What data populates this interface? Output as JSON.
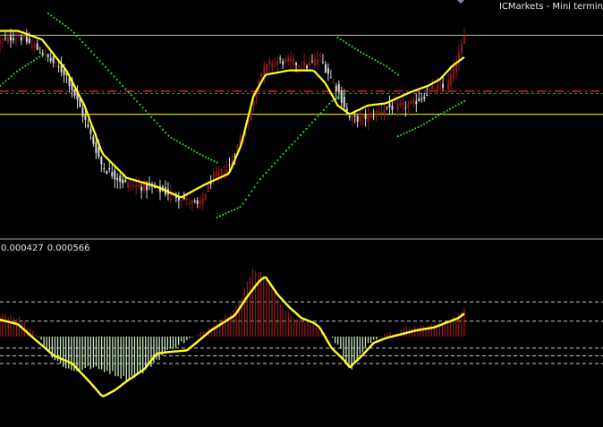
{
  "window": {
    "broker_label": "ICMarkets - Mini termin"
  },
  "colors": {
    "background": "#000000",
    "bull_candle": "#8b1a1a",
    "bear_candle": "#d8d8d8",
    "ma_line": "#ffff22",
    "envelope_dots": "#2ee82e",
    "level_line": "#ffff00",
    "mid_level_red": "#ff2a2a",
    "mid_level_green": "#00c000",
    "hist_pos": "#8b1a1a",
    "hist_neg": "#c8e8c0",
    "signal_line": "#ffff22",
    "osc_level": "#c8c8c8",
    "divider": "#a0a0a0"
  },
  "indicator": {
    "value_1": "0.000427",
    "value_2": "0.000566"
  },
  "chart_data": [
    {
      "type": "candlestick",
      "title": "",
      "xlabel": "",
      "ylabel": "",
      "grid": false,
      "ylim": [
        0,
        100
      ],
      "close_path": [
        [
          0,
          85
        ],
        [
          0.03,
          88
        ],
        [
          0.07,
          80
        ],
        [
          0.11,
          70
        ],
        [
          0.14,
          50
        ],
        [
          0.17,
          28
        ],
        [
          0.21,
          20
        ],
        [
          0.26,
          18
        ],
        [
          0.3,
          14
        ],
        [
          0.33,
          10
        ],
        [
          0.35,
          22
        ],
        [
          0.38,
          28
        ],
        [
          0.41,
          48
        ],
        [
          0.43,
          70
        ],
        [
          0.45,
          76
        ],
        [
          0.48,
          76
        ],
        [
          0.51,
          74
        ],
        [
          0.53,
          78
        ],
        [
          0.56,
          63
        ],
        [
          0.58,
          50
        ],
        [
          0.6,
          50
        ],
        [
          0.62,
          52
        ],
        [
          0.64,
          55
        ],
        [
          0.68,
          56
        ],
        [
          0.72,
          64
        ],
        [
          0.74,
          64
        ],
        [
          0.76,
          78
        ],
        [
          0.77,
          87
        ]
      ],
      "ma_path": [
        [
          0,
          90
        ],
        [
          0.03,
          90
        ],
        [
          0.07,
          86
        ],
        [
          0.11,
          72
        ],
        [
          0.14,
          56
        ],
        [
          0.17,
          34
        ],
        [
          0.21,
          23
        ],
        [
          0.26,
          19
        ],
        [
          0.3,
          14
        ],
        [
          0.34,
          20
        ],
        [
          0.38,
          25
        ],
        [
          0.4,
          38
        ],
        [
          0.42,
          60
        ],
        [
          0.44,
          70
        ],
        [
          0.48,
          72
        ],
        [
          0.52,
          72
        ],
        [
          0.54,
          66
        ],
        [
          0.56,
          56
        ],
        [
          0.58,
          52
        ],
        [
          0.61,
          56
        ],
        [
          0.64,
          57
        ],
        [
          0.68,
          62
        ],
        [
          0.71,
          65
        ],
        [
          0.73,
          68
        ],
        [
          0.75,
          74
        ],
        [
          0.77,
          78
        ]
      ],
      "envelope_segments": [
        [
          [
            0,
            65
          ],
          [
            0.03,
            72
          ],
          [
            0.07,
            79
          ]
        ],
        [
          [
            0.08,
            98
          ],
          [
            0.12,
            90
          ],
          [
            0.16,
            78
          ],
          [
            0.2,
            66
          ],
          [
            0.24,
            54
          ],
          [
            0.28,
            42
          ],
          [
            0.33,
            34
          ],
          [
            0.36,
            30
          ]
        ],
        [
          [
            0.36,
            5
          ],
          [
            0.4,
            10
          ],
          [
            0.43,
            22
          ],
          [
            0.47,
            34
          ],
          [
            0.51,
            46
          ],
          [
            0.55,
            58
          ],
          [
            0.57,
            61
          ]
        ],
        [
          [
            0.56,
            87
          ],
          [
            0.6,
            80
          ],
          [
            0.64,
            74
          ],
          [
            0.66,
            70
          ]
        ],
        [
          [
            0.66,
            42
          ],
          [
            0.7,
            47
          ],
          [
            0.73,
            52
          ],
          [
            0.77,
            58
          ]
        ]
      ],
      "levels": [
        88,
        62.5,
        61.5,
        52
      ]
    },
    {
      "type": "bar+line",
      "title": "",
      "xlabel": "",
      "ylabel": "",
      "grid": false,
      "ylim": [
        -100,
        100
      ],
      "histogram_path": [
        [
          0,
          30
        ],
        [
          0.03,
          25
        ],
        [
          0.06,
          4
        ],
        [
          0.09,
          -30
        ],
        [
          0.12,
          -45
        ],
        [
          0.15,
          -40
        ],
        [
          0.18,
          -45
        ],
        [
          0.21,
          -55
        ],
        [
          0.24,
          -45
        ],
        [
          0.26,
          -30
        ],
        [
          0.29,
          -12
        ],
        [
          0.31,
          -5
        ],
        [
          0.33,
          2
        ],
        [
          0.36,
          20
        ],
        [
          0.38,
          30
        ],
        [
          0.4,
          50
        ],
        [
          0.42,
          88
        ],
        [
          0.44,
          80
        ],
        [
          0.46,
          50
        ],
        [
          0.48,
          28
        ],
        [
          0.5,
          20
        ],
        [
          0.52,
          15
        ],
        [
          0.54,
          4
        ],
        [
          0.56,
          -10
        ],
        [
          0.58,
          -45
        ],
        [
          0.6,
          -20
        ],
        [
          0.62,
          -2
        ],
        [
          0.65,
          4
        ],
        [
          0.68,
          12
        ],
        [
          0.72,
          15
        ],
        [
          0.74,
          20
        ],
        [
          0.76,
          28
        ],
        [
          0.77,
          35
        ]
      ],
      "signal_path": [
        [
          0,
          22
        ],
        [
          0.03,
          16
        ],
        [
          0.06,
          -5
        ],
        [
          0.09,
          -25
        ],
        [
          0.12,
          -35
        ],
        [
          0.15,
          -60
        ],
        [
          0.17,
          -78
        ],
        [
          0.19,
          -70
        ],
        [
          0.21,
          -58
        ],
        [
          0.24,
          -42
        ],
        [
          0.26,
          -22
        ],
        [
          0.28,
          -20
        ],
        [
          0.31,
          -18
        ],
        [
          0.33,
          -5
        ],
        [
          0.35,
          8
        ],
        [
          0.37,
          18
        ],
        [
          0.39,
          28
        ],
        [
          0.41,
          52
        ],
        [
          0.43,
          72
        ],
        [
          0.44,
          78
        ],
        [
          0.46,
          55
        ],
        [
          0.48,
          38
        ],
        [
          0.5,
          24
        ],
        [
          0.52,
          18
        ],
        [
          0.53,
          12
        ],
        [
          0.55,
          -15
        ],
        [
          0.57,
          -30
        ],
        [
          0.58,
          -40
        ],
        [
          0.6,
          -25
        ],
        [
          0.62,
          -8
        ],
        [
          0.64,
          -2
        ],
        [
          0.66,
          2
        ],
        [
          0.69,
          8
        ],
        [
          0.72,
          12
        ],
        [
          0.74,
          18
        ],
        [
          0.76,
          24
        ],
        [
          0.77,
          30
        ]
      ],
      "levels": [
        45,
        20,
        -15,
        -25,
        -35
      ]
    }
  ]
}
